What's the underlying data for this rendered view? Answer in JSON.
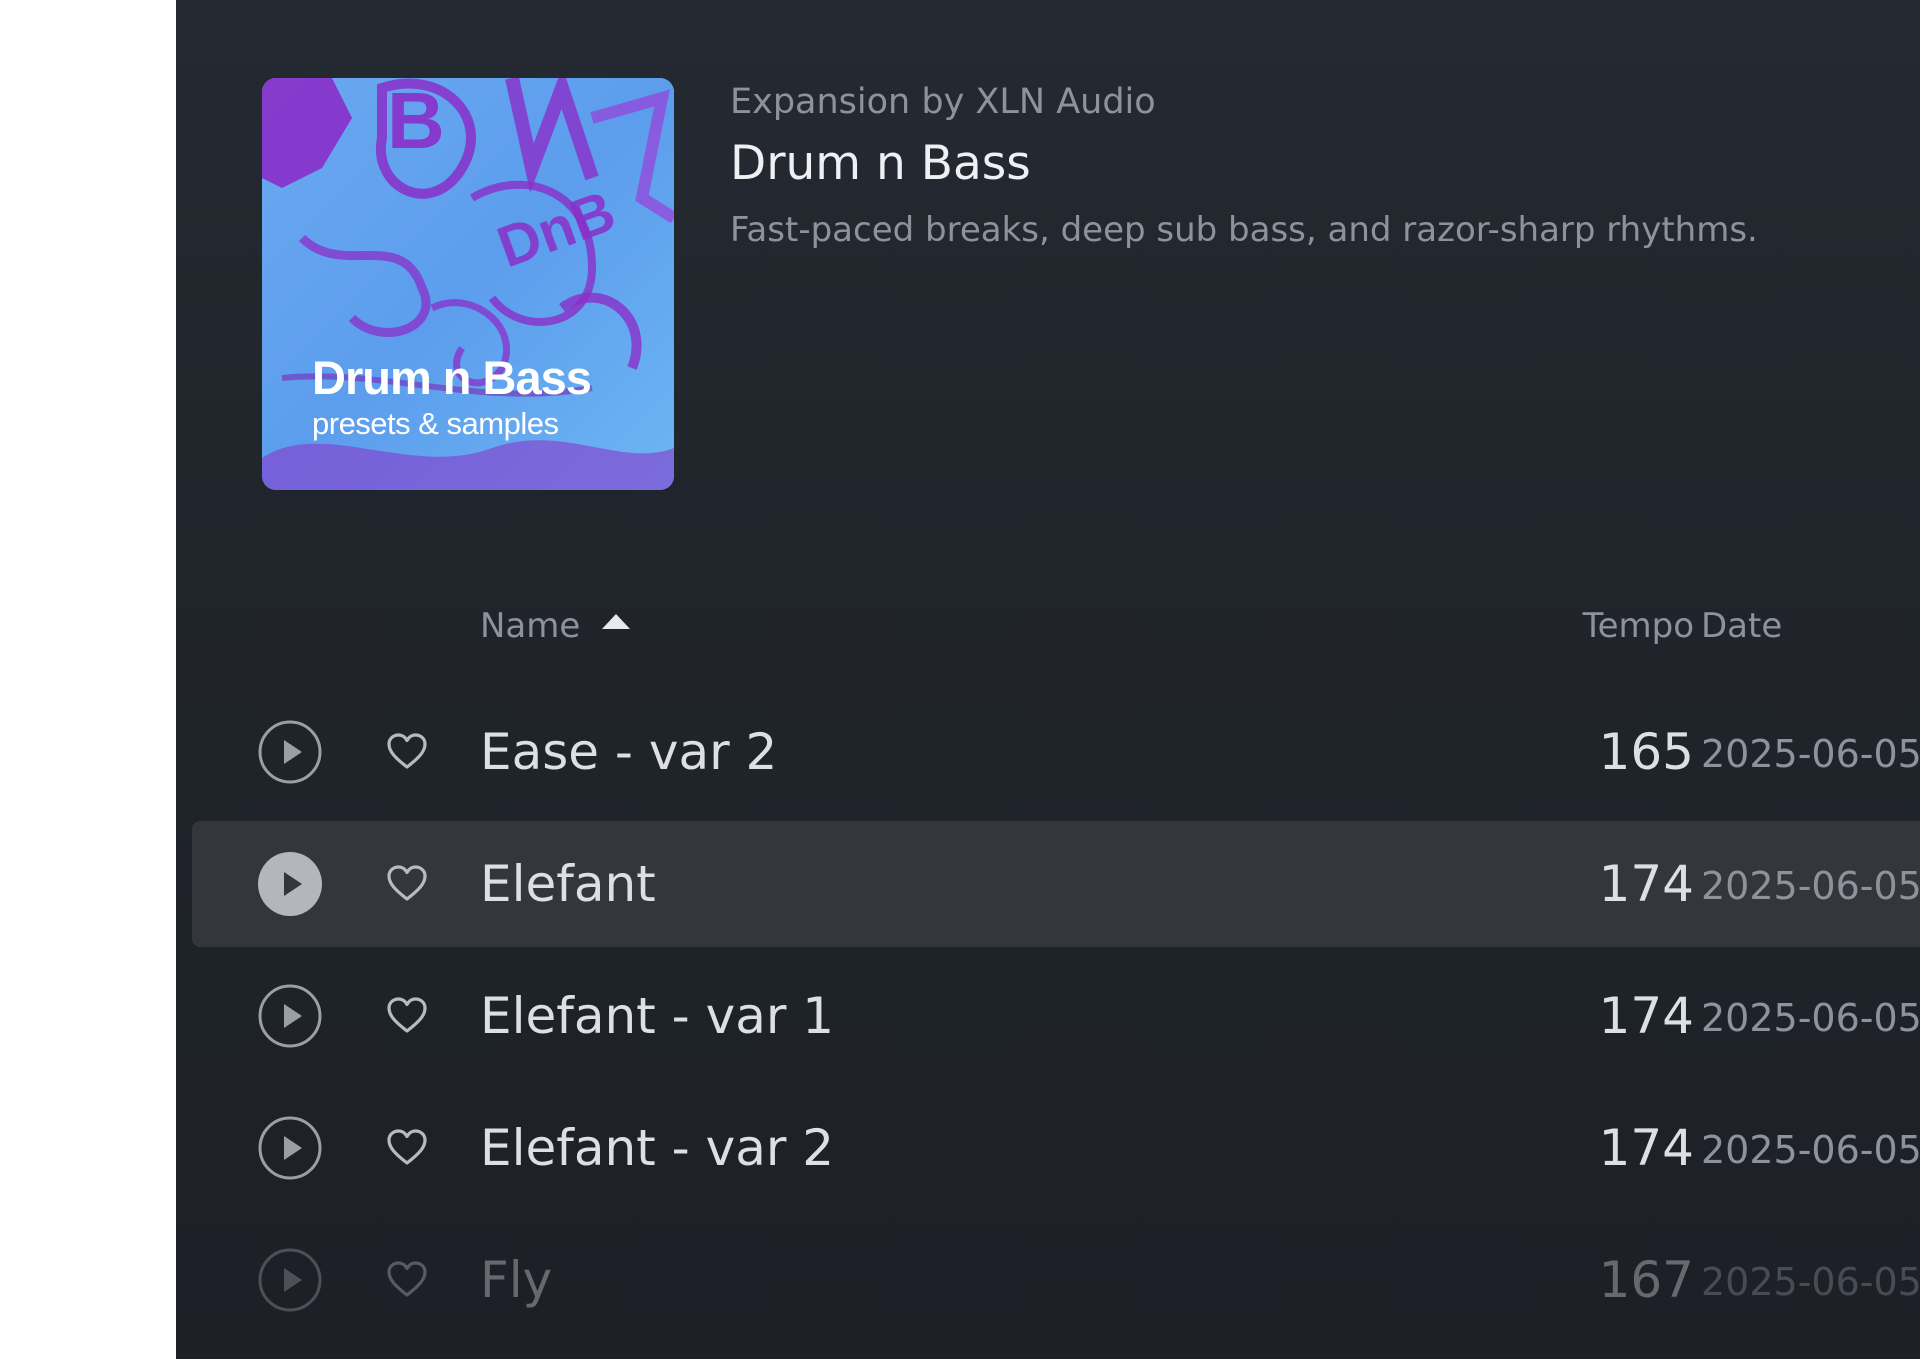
{
  "header": {
    "kicker": "Expansion by XLN Audio",
    "title": "Drum n Bass",
    "description": "Fast-paced breaks, deep sub bass, and razor-sharp rhythms.",
    "cover": {
      "title": "Drum n Bass",
      "subtitle": "presets & samples",
      "graffiti": [
        "B",
        "DnB"
      ]
    }
  },
  "table": {
    "columns": {
      "name": "Name",
      "tempo": "Tempo",
      "date": "Date"
    },
    "sort": {
      "column": "name",
      "direction": "ascending"
    },
    "rows": [
      {
        "name": "Ease - var 2",
        "tempo": "165",
        "date": "2025-06-05",
        "selected": false,
        "faded": false
      },
      {
        "name": "Elefant",
        "tempo": "174",
        "date": "2025-06-05",
        "selected": true,
        "faded": false
      },
      {
        "name": "Elefant - var 1",
        "tempo": "174",
        "date": "2025-06-05",
        "selected": false,
        "faded": false
      },
      {
        "name": "Elefant - var 2",
        "tempo": "174",
        "date": "2025-06-05",
        "selected": false,
        "faded": false
      },
      {
        "name": "Fly",
        "tempo": "167",
        "date": "2025-06-05",
        "selected": false,
        "faded": true
      }
    ]
  },
  "colors": {
    "panel_background": "#20242b",
    "selected_row": "#34363b",
    "text_primary": "#dcdfe3",
    "text_secondary": "#8d939c",
    "cover_blue": "#5aa7ef",
    "cover_purple": "#8a2fc9"
  },
  "icons": {
    "play": "play-circle-icon",
    "favorite": "heart-outline-icon",
    "sort": "sort-ascending-icon"
  }
}
